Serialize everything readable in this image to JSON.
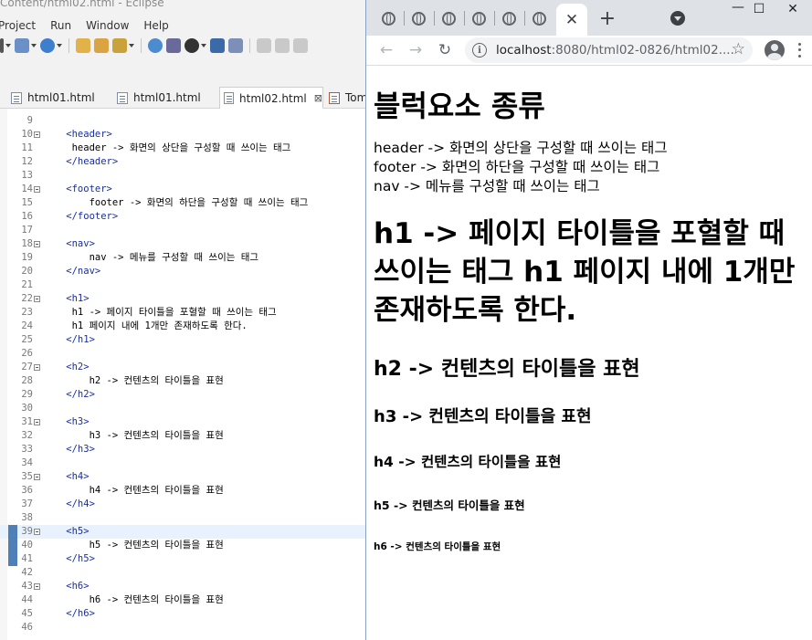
{
  "eclipse": {
    "window_title": "Content/html02.html - Eclipse",
    "menu": [
      "Project",
      "Run",
      "Window",
      "Help"
    ],
    "tabs": [
      {
        "label": "html01.html",
        "active": false
      },
      {
        "label": "html01.html",
        "active": false
      },
      {
        "label": "html02.html",
        "active": true,
        "close": "⊠"
      },
      {
        "label": "Tom",
        "active": false
      }
    ],
    "lines": [
      {
        "n": "9",
        "text": ""
      },
      {
        "n": "10",
        "fold": true,
        "text": "    <header>"
      },
      {
        "n": "11",
        "text": "     header -> 화면의 상단을 구성할 때 쓰이는 태그"
      },
      {
        "n": "12",
        "text": "    </header>"
      },
      {
        "n": "13",
        "text": ""
      },
      {
        "n": "14",
        "fold": true,
        "text": "    <footer>"
      },
      {
        "n": "15",
        "text": "        footer -> 화면의 하단을 구성할 때 쓰이는 태그"
      },
      {
        "n": "16",
        "text": "    </footer>"
      },
      {
        "n": "17",
        "text": ""
      },
      {
        "n": "18",
        "fold": true,
        "text": "    <nav>"
      },
      {
        "n": "19",
        "text": "        nav -> 메뉴를 구성할 때 쓰이는 태그"
      },
      {
        "n": "20",
        "text": "    </nav>"
      },
      {
        "n": "21",
        "text": ""
      },
      {
        "n": "22",
        "fold": true,
        "text": "    <h1>"
      },
      {
        "n": "23",
        "text": "     h1 -> 페이지 타이틀을 포혈할 때 쓰이는 태그"
      },
      {
        "n": "24",
        "text": "     h1 페이지 내에 1개만 존재하도록 한다."
      },
      {
        "n": "25",
        "text": "    </h1>"
      },
      {
        "n": "26",
        "text": ""
      },
      {
        "n": "27",
        "fold": true,
        "text": "    <h2>"
      },
      {
        "n": "28",
        "text": "        h2 -> 컨텐츠의 타이틀을 표현"
      },
      {
        "n": "29",
        "text": "    </h2>"
      },
      {
        "n": "30",
        "text": ""
      },
      {
        "n": "31",
        "fold": true,
        "text": "    <h3>"
      },
      {
        "n": "32",
        "text": "        h3 -> 컨텐츠의 타이틀을 표현"
      },
      {
        "n": "33",
        "text": "    </h3>"
      },
      {
        "n": "34",
        "text": ""
      },
      {
        "n": "35",
        "fold": true,
        "text": "    <h4>"
      },
      {
        "n": "36",
        "text": "        h4 -> 컨텐츠의 타이틀을 표현"
      },
      {
        "n": "37",
        "text": "    </h4>"
      },
      {
        "n": "38",
        "text": ""
      },
      {
        "n": "39",
        "fold": true,
        "current": true,
        "text": "    <h5>"
      },
      {
        "n": "40",
        "text": "        h5 -> 컨텐츠의 타이틀을 표현"
      },
      {
        "n": "41",
        "text": "    </h5>"
      },
      {
        "n": "42",
        "text": ""
      },
      {
        "n": "43",
        "fold": true,
        "text": "    <h6>"
      },
      {
        "n": "44",
        "text": "        h6 -> 컨텐츠의 타이틀을 표현"
      },
      {
        "n": "45",
        "text": "    </h6>"
      },
      {
        "n": "46",
        "text": ""
      }
    ],
    "colors": {
      "tag": "#1a2e9e",
      "current_line": "#e8f2fe",
      "marker": "#4f7fb8"
    }
  },
  "chrome": {
    "tab_icons": [
      "globe-icon",
      "globe-icon",
      "globe-icon",
      "globe-icon",
      "globe-icon",
      "globe-icon"
    ],
    "active_tab_close": "✕",
    "new_tab": "+",
    "window_controls": {
      "minimize": "—",
      "maximize": "☐",
      "close": "✕"
    },
    "nav": {
      "back": "←",
      "forward": "→",
      "reload": "↻"
    },
    "url_host": "localhost",
    "url_rest": ":8080/html02-0826/html02....",
    "star": "☆",
    "page": {
      "h1": "블럭요소 종류",
      "lines": [
        "header -> 화면의 상단을 구성할 때 쓰이는 태그",
        "footer -> 화면의 하단을 구성할 때 쓰이는 태그",
        "nav -> 메뉴를 구성할 때 쓰이는 태그"
      ],
      "h1_second": "h1 -> 페이지 타이틀을 포혈할 때 쓰이는 태그 h1 페이지 내에 1개만 존재하도록 한다.",
      "h2": "h2 -> 컨텐츠의 타이틀을 표현",
      "h3": "h3 -> 컨텐츠의 타이틀을 표현",
      "h4": "h4 -> 컨텐츠의 타이틀을 표현",
      "h5": "h5 -> 컨텐츠의 타이틀을 표현",
      "h6": "h6 -> 컨텐츠의 타이틀을 표현"
    }
  }
}
